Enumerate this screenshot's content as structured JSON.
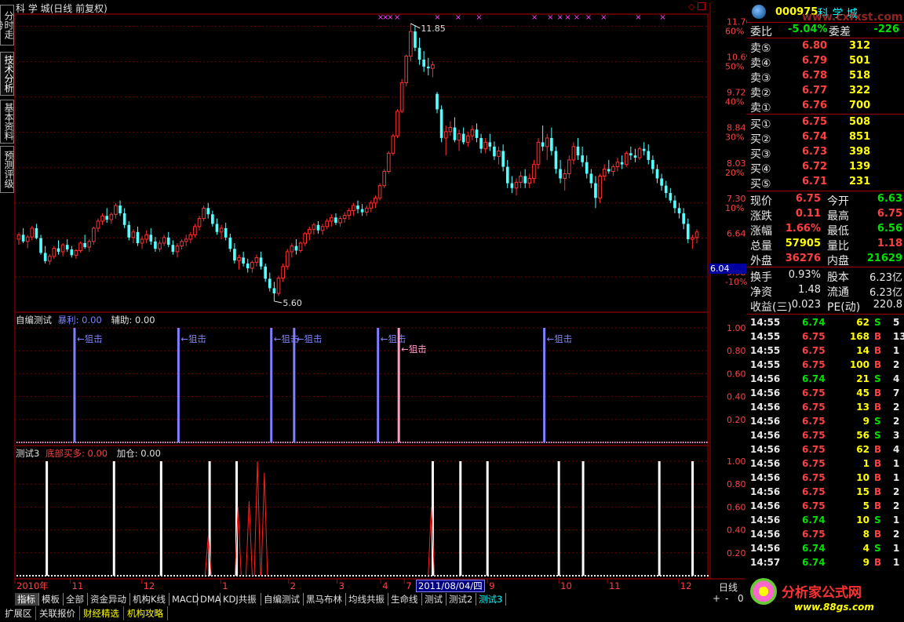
{
  "window": {
    "title": "科 学 城(日线 前复权)"
  },
  "left_tabs": [
    {
      "label": "分时走势",
      "active": false
    },
    {
      "label": "技术分析",
      "active": true
    },
    {
      "label": "基本资料",
      "active": false
    },
    {
      "label": "预测评级",
      "active": false
    }
  ],
  "price_axis": {
    "levels": [
      {
        "price": "11.76",
        "pct": "60%"
      },
      {
        "price": "10.69",
        "pct": "50%"
      },
      {
        "price": "9.72",
        "pct": "40%"
      },
      {
        "price": "8.84",
        "pct": "30%"
      },
      {
        "price": "8.03",
        "pct": "20%"
      },
      {
        "price": "7.30",
        "pct": "10%"
      },
      {
        "price": "6.64",
        "pct": ""
      },
      {
        "price": "5.98",
        "pct": "-10%"
      }
    ],
    "current_price_box": "6.04"
  },
  "annotations": {
    "high_label": "11.85",
    "low_label": "5.60"
  },
  "panel1": {
    "title": "自编测试",
    "l1": "暴利: 0.00",
    "l2": "辅助: 0.00",
    "axis": [
      "1.00",
      "0.80",
      "0.60",
      "0.40",
      "0.20"
    ],
    "signal_text": "←狙击"
  },
  "panel2": {
    "title": "测试3",
    "l1": "底部买多: 0.00",
    "l2": "加仓: 0.00",
    "axis": [
      "1.00",
      "0.80",
      "0.60",
      "0.40",
      "0.20"
    ]
  },
  "time_axis": {
    "labels": [
      "2010年",
      "11",
      "12",
      "1",
      "2",
      "3",
      "4",
      "7",
      "8",
      "9",
      "10",
      "11",
      "12"
    ],
    "cursor_date": "2011/08/04/四",
    "period": "日线"
  },
  "bottom_tabs": [
    "指标",
    "模板",
    "全部",
    "资金异动",
    "机构K线",
    "MACD",
    "DMA",
    "KDJ共振",
    "自编测试",
    "黑马布林",
    "均线共振",
    "生命线",
    "测试",
    "测试2",
    "测试3"
  ],
  "bottom_tab_active": "指标",
  "bottom_tab_highlight": "测试3",
  "scroll_controls": [
    "+",
    "-",
    "0"
  ],
  "ext_tabs": [
    "扩展区",
    "关联报价",
    "财经精选",
    "机构攻略"
  ],
  "quote": {
    "code": "000975",
    "name": "科 学 城",
    "watermark": "www.cxfxst.com",
    "webi": {
      "label": "委比",
      "value": "-5.04%",
      "label2": "委差",
      "value2": "-226"
    },
    "sell": [
      {
        "label": "卖⑤",
        "price": "6.80",
        "vol": "312"
      },
      {
        "label": "卖④",
        "price": "6.79",
        "vol": "501"
      },
      {
        "label": "卖③",
        "price": "6.78",
        "vol": "518"
      },
      {
        "label": "卖②",
        "price": "6.77",
        "vol": "322"
      },
      {
        "label": "卖①",
        "price": "6.76",
        "vol": "700"
      }
    ],
    "buy": [
      {
        "label": "买①",
        "price": "6.75",
        "vol": "508"
      },
      {
        "label": "买②",
        "price": "6.74",
        "vol": "851"
      },
      {
        "label": "买③",
        "price": "6.73",
        "vol": "398"
      },
      {
        "label": "买④",
        "price": "6.72",
        "vol": "139"
      },
      {
        "label": "买⑤",
        "price": "6.71",
        "vol": "231"
      }
    ],
    "stats": [
      {
        "l": "现价",
        "v": "6.75",
        "c": "red",
        "l2": "今开",
        "v2": "6.63",
        "c2": "green"
      },
      {
        "l": "涨跌",
        "v": "0.11",
        "c": "red",
        "l2": "最高",
        "v2": "6.75",
        "c2": "red"
      },
      {
        "l": "涨幅",
        "v": "1.66%",
        "c": "red",
        "l2": "最低",
        "v2": "6.56",
        "c2": "green"
      },
      {
        "l": "总量",
        "v": "57905",
        "c": "yellow",
        "l2": "量比",
        "v2": "1.18",
        "c2": "red"
      },
      {
        "l": "外盘",
        "v": "36276",
        "c": "red",
        "l2": "内盘",
        "v2": "21629",
        "c2": "green"
      }
    ],
    "stats2": [
      {
        "l": "换手",
        "v": "0.93%",
        "l2": "股本",
        "v2": "6.23亿"
      },
      {
        "l": "净资",
        "v": "1.48",
        "l2": "流通",
        "v2": "6.23亿"
      },
      {
        "l": "收益(三)",
        "v": "0.023",
        "l2": "PE(动)",
        "v2": "220.8"
      }
    ],
    "ticks": [
      {
        "t": "14:55",
        "p": "6.74",
        "v": "62",
        "s": "S",
        "n": "5"
      },
      {
        "t": "14:55",
        "p": "6.75",
        "v": "168",
        "s": "B",
        "n": "13"
      },
      {
        "t": "14:55",
        "p": "6.75",
        "v": "14",
        "s": "B",
        "n": "1"
      },
      {
        "t": "14:55",
        "p": "6.75",
        "v": "100",
        "s": "B",
        "n": "2"
      },
      {
        "t": "14:56",
        "p": "6.74",
        "v": "21",
        "s": "S",
        "n": "4"
      },
      {
        "t": "14:56",
        "p": "6.75",
        "v": "45",
        "s": "B",
        "n": "7"
      },
      {
        "t": "14:56",
        "p": "6.75",
        "v": "13",
        "s": "B",
        "n": "2"
      },
      {
        "t": "14:56",
        "p": "6.75",
        "v": "9",
        "s": "S",
        "n": "2"
      },
      {
        "t": "14:56",
        "p": "6.75",
        "v": "56",
        "s": "S",
        "n": "3"
      },
      {
        "t": "14:56",
        "p": "6.75",
        "v": "62",
        "s": "B",
        "n": "4"
      },
      {
        "t": "14:56",
        "p": "6.75",
        "v": "1",
        "s": "B",
        "n": "1"
      },
      {
        "t": "14:56",
        "p": "6.75",
        "v": "10",
        "s": "B",
        "n": "1"
      },
      {
        "t": "14:56",
        "p": "6.75",
        "v": "15",
        "s": "B",
        "n": "2"
      },
      {
        "t": "14:56",
        "p": "6.75",
        "v": "5",
        "s": "B",
        "n": "2"
      },
      {
        "t": "14:56",
        "p": "6.74",
        "v": "10",
        "s": "S",
        "n": "1"
      },
      {
        "t": "14:56",
        "p": "6.75",
        "v": "8",
        "s": "B",
        "n": "2"
      },
      {
        "t": "14:56",
        "p": "6.74",
        "v": "4",
        "s": "S",
        "n": "1"
      },
      {
        "t": "14:57",
        "p": "6.74",
        "v": "9",
        "s": "B",
        "n": "1"
      }
    ],
    "logo_text": "分析家公式网",
    "logo_url_text": "www.88gs.com"
  },
  "colors": {
    "up": "#ff3030",
    "down": "#54ffff",
    "grid": "#700000",
    "axis": "#b00000",
    "signal_blue": "#7f7fff",
    "signal_pink": "#ff99cc",
    "white_bar": "#ffffff"
  },
  "chart_data": {
    "type": "candlestick",
    "title": "科 学 城(日线 前复权)",
    "ylim": [
      5.6,
      11.85
    ],
    "ohlc": [
      [
        6.62,
        6.74,
        6.52,
        6.7
      ],
      [
        6.7,
        6.82,
        6.55,
        6.58
      ],
      [
        6.58,
        6.7,
        6.46,
        6.66
      ],
      [
        6.66,
        6.86,
        6.6,
        6.82
      ],
      [
        6.82,
        6.9,
        6.62,
        6.64
      ],
      [
        6.64,
        6.7,
        6.35,
        6.38
      ],
      [
        6.38,
        6.5,
        6.2,
        6.24
      ],
      [
        6.24,
        6.36,
        6.18,
        6.32
      ],
      [
        6.32,
        6.5,
        6.28,
        6.46
      ],
      [
        6.46,
        6.6,
        6.35,
        6.4
      ],
      [
        6.4,
        6.55,
        6.32,
        6.52
      ],
      [
        6.52,
        6.62,
        6.4,
        6.44
      ],
      [
        6.44,
        6.5,
        6.3,
        6.34
      ],
      [
        6.34,
        6.45,
        6.28,
        6.42
      ],
      [
        6.42,
        6.58,
        6.38,
        6.55
      ],
      [
        6.55,
        6.7,
        6.45,
        6.48
      ],
      [
        6.48,
        6.62,
        6.4,
        6.58
      ],
      [
        6.58,
        6.85,
        6.52,
        6.82
      ],
      [
        6.82,
        7.0,
        6.75,
        6.95
      ],
      [
        6.95,
        7.1,
        6.88,
        7.05
      ],
      [
        7.05,
        7.2,
        6.92,
        6.98
      ],
      [
        6.98,
        7.12,
        6.9,
        7.08
      ],
      [
        7.08,
        7.3,
        7.0,
        7.25
      ],
      [
        7.25,
        7.35,
        7.05,
        7.1
      ],
      [
        7.1,
        7.2,
        6.82,
        6.88
      ],
      [
        6.88,
        6.95,
        6.6,
        6.65
      ],
      [
        6.65,
        6.8,
        6.55,
        6.75
      ],
      [
        6.75,
        6.85,
        6.5,
        6.55
      ],
      [
        6.55,
        6.68,
        6.45,
        6.62
      ],
      [
        6.62,
        6.78,
        6.55,
        6.7
      ],
      [
        6.7,
        6.82,
        6.52,
        6.58
      ],
      [
        6.58,
        6.66,
        6.4,
        6.45
      ],
      [
        6.45,
        6.6,
        6.4,
        6.55
      ],
      [
        6.55,
        6.7,
        6.5,
        6.65
      ],
      [
        6.65,
        6.75,
        6.48,
        6.52
      ],
      [
        6.52,
        6.6,
        6.35,
        6.4
      ],
      [
        6.4,
        6.55,
        6.3,
        6.5
      ],
      [
        6.5,
        6.62,
        6.44,
        6.58
      ],
      [
        6.58,
        6.7,
        6.5,
        6.62
      ],
      [
        6.62,
        6.75,
        6.55,
        6.7
      ],
      [
        6.7,
        6.9,
        6.65,
        6.85
      ],
      [
        6.85,
        7.05,
        6.78,
        7.0
      ],
      [
        7.0,
        7.25,
        6.95,
        7.2
      ],
      [
        7.2,
        7.3,
        7.0,
        7.08
      ],
      [
        7.08,
        7.15,
        6.85,
        6.9
      ],
      [
        6.9,
        7.0,
        6.7,
        6.75
      ],
      [
        6.75,
        6.88,
        6.62,
        6.82
      ],
      [
        6.82,
        6.92,
        6.6,
        6.65
      ],
      [
        6.65,
        6.72,
        6.4,
        6.45
      ],
      [
        6.45,
        6.55,
        6.2,
        6.25
      ],
      [
        6.25,
        6.35,
        6.1,
        6.3
      ],
      [
        6.3,
        6.4,
        6.15,
        6.2
      ],
      [
        6.2,
        6.28,
        6.05,
        6.12
      ],
      [
        6.12,
        6.25,
        6.05,
        6.22
      ],
      [
        6.22,
        6.35,
        6.15,
        6.3
      ],
      [
        6.3,
        6.4,
        6.1,
        6.15
      ],
      [
        6.15,
        6.2,
        5.9,
        5.95
      ],
      [
        5.95,
        6.05,
        5.75,
        5.8
      ],
      [
        5.8,
        5.9,
        5.6,
        5.72
      ],
      [
        5.72,
        6.0,
        5.68,
        5.96
      ],
      [
        5.96,
        6.2,
        5.9,
        6.15
      ],
      [
        6.15,
        6.45,
        6.1,
        6.4
      ],
      [
        6.4,
        6.55,
        6.3,
        6.5
      ],
      [
        6.5,
        6.62,
        6.35,
        6.42
      ],
      [
        6.42,
        6.58,
        6.38,
        6.55
      ],
      [
        6.55,
        6.75,
        6.5,
        6.72
      ],
      [
        6.72,
        6.85,
        6.6,
        6.8
      ],
      [
        6.8,
        6.92,
        6.7,
        6.88
      ],
      [
        6.88,
        6.95,
        6.72,
        6.78
      ],
      [
        6.78,
        6.9,
        6.7,
        6.85
      ],
      [
        6.85,
        7.0,
        6.8,
        6.95
      ],
      [
        6.95,
        7.08,
        6.85,
        7.02
      ],
      [
        7.02,
        7.1,
        6.88,
        6.92
      ],
      [
        6.92,
        7.05,
        6.85,
        7.0
      ],
      [
        7.0,
        7.12,
        6.92,
        7.06
      ],
      [
        7.06,
        7.2,
        6.98,
        7.15
      ],
      [
        7.15,
        7.3,
        7.05,
        7.25
      ],
      [
        7.25,
        7.35,
        7.1,
        7.18
      ],
      [
        7.18,
        7.28,
        7.05,
        7.12
      ],
      [
        7.12,
        7.25,
        7.05,
        7.2
      ],
      [
        7.2,
        7.35,
        7.12,
        7.3
      ],
      [
        7.3,
        7.45,
        7.2,
        7.4
      ],
      [
        7.4,
        7.7,
        7.35,
        7.65
      ],
      [
        7.65,
        8.0,
        7.6,
        7.95
      ],
      [
        7.95,
        8.4,
        7.9,
        8.35
      ],
      [
        8.35,
        8.8,
        8.3,
        8.75
      ],
      [
        8.75,
        9.4,
        8.7,
        9.35
      ],
      [
        9.35,
        10.2,
        9.3,
        10.1
      ],
      [
        10.1,
        10.9,
        10.0,
        10.85
      ],
      [
        10.85,
        11.85,
        10.7,
        11.6
      ],
      [
        11.6,
        11.8,
        11.0,
        11.1
      ],
      [
        11.1,
        11.4,
        10.6,
        10.75
      ],
      [
        10.75,
        11.0,
        10.4,
        10.55
      ],
      [
        10.55,
        10.8,
        10.3,
        10.5
      ],
      [
        10.5,
        10.7,
        10.25,
        10.6
      ],
      [
        9.8,
        9.85,
        9.3,
        9.4
      ],
      [
        9.4,
        9.5,
        8.6,
        8.7
      ],
      [
        8.7,
        9.0,
        8.3,
        8.85
      ],
      [
        8.85,
        9.1,
        8.75,
        8.95
      ],
      [
        8.95,
        9.2,
        8.6,
        8.65
      ],
      [
        8.65,
        8.9,
        8.4,
        8.8
      ],
      [
        8.8,
        8.95,
        8.55,
        8.6
      ],
      [
        8.6,
        8.85,
        8.5,
        8.75
      ],
      [
        8.75,
        9.0,
        8.65,
        8.9
      ],
      [
        8.9,
        9.05,
        8.6,
        8.7
      ],
      [
        8.7,
        8.8,
        8.35,
        8.45
      ],
      [
        8.45,
        8.7,
        8.35,
        8.6
      ],
      [
        8.6,
        8.8,
        8.4,
        8.5
      ],
      [
        8.5,
        8.62,
        8.2,
        8.28
      ],
      [
        8.28,
        8.5,
        8.1,
        8.4
      ],
      [
        8.4,
        8.55,
        7.95,
        8.05
      ],
      [
        8.05,
        8.2,
        7.6,
        7.7
      ],
      [
        7.7,
        7.85,
        7.5,
        7.6
      ],
      [
        7.6,
        7.8,
        7.45,
        7.72
      ],
      [
        7.72,
        7.95,
        7.6,
        7.85
      ],
      [
        7.85,
        8.0,
        7.6,
        7.7
      ],
      [
        7.7,
        7.9,
        7.6,
        7.8
      ],
      [
        7.8,
        8.2,
        7.7,
        8.1
      ],
      [
        8.1,
        8.7,
        8.0,
        8.6
      ],
      [
        8.6,
        9.0,
        8.4,
        8.5
      ],
      [
        8.5,
        8.8,
        8.2,
        8.7
      ],
      [
        8.7,
        8.95,
        8.3,
        8.4
      ],
      [
        8.4,
        8.5,
        7.9,
        8.0
      ],
      [
        8.0,
        8.2,
        7.7,
        7.8
      ],
      [
        7.8,
        8.0,
        7.55,
        7.9
      ],
      [
        7.9,
        8.3,
        7.8,
        8.2
      ],
      [
        8.2,
        8.6,
        8.1,
        8.5
      ],
      [
        8.5,
        8.7,
        8.2,
        8.3
      ],
      [
        8.3,
        8.5,
        8.05,
        8.15
      ],
      [
        8.15,
        8.3,
        7.8,
        7.9
      ],
      [
        7.9,
        8.0,
        7.6,
        7.7
      ],
      [
        7.7,
        7.85,
        7.2,
        7.4
      ],
      [
        7.4,
        7.9,
        7.3,
        7.85
      ],
      [
        7.85,
        8.1,
        7.75,
        8.0
      ],
      [
        8.0,
        8.2,
        7.9,
        7.95
      ],
      [
        7.95,
        8.1,
        7.85,
        8.05
      ],
      [
        8.05,
        8.25,
        7.95,
        8.15
      ],
      [
        8.15,
        8.3,
        8.0,
        8.1
      ],
      [
        8.1,
        8.4,
        8.05,
        8.35
      ],
      [
        8.35,
        8.5,
        8.2,
        8.3
      ],
      [
        8.3,
        8.45,
        8.15,
        8.25
      ],
      [
        8.25,
        8.5,
        8.2,
        8.45
      ],
      [
        8.45,
        8.6,
        8.3,
        8.4
      ],
      [
        8.4,
        8.55,
        8.1,
        8.2
      ],
      [
        8.2,
        8.3,
        7.9,
        8.0
      ],
      [
        8.0,
        8.1,
        7.7,
        7.8
      ],
      [
        7.8,
        7.9,
        7.55,
        7.65
      ],
      [
        7.65,
        7.75,
        7.4,
        7.5
      ],
      [
        7.5,
        7.6,
        7.3,
        7.35
      ],
      [
        7.35,
        7.45,
        7.1,
        7.2
      ],
      [
        7.2,
        7.3,
        7.0,
        7.1
      ],
      [
        7.1,
        7.2,
        6.8,
        6.9
      ],
      [
        6.9,
        7.0,
        6.55,
        6.62
      ],
      [
        6.62,
        6.7,
        6.45,
        6.65
      ],
      [
        6.65,
        6.8,
        6.55,
        6.75
      ]
    ],
    "panel1_signals": [
      {
        "x": 0.086,
        "color": "signal_blue",
        "label": true
      },
      {
        "x": 0.236,
        "color": "signal_blue",
        "label": true
      },
      {
        "x": 0.37,
        "color": "signal_blue",
        "label": true
      },
      {
        "x": 0.403,
        "color": "signal_blue",
        "label": true
      },
      {
        "x": 0.524,
        "color": "signal_blue",
        "label": true
      },
      {
        "x": 0.554,
        "color": "signal_pink",
        "label": true
      },
      {
        "x": 0.764,
        "color": "signal_blue",
        "label": true
      }
    ],
    "panel2_bars": [
      0.046,
      0.143,
      0.211,
      0.281,
      0.32,
      0.603,
      0.643,
      0.682,
      0.785,
      0.82,
      0.93,
      0.978
    ],
    "panel2_spikes": [
      {
        "x": 0.279,
        "h": 0.35
      },
      {
        "x": 0.322,
        "h": 0.6
      },
      {
        "x": 0.338,
        "h": 0.65
      },
      {
        "x": 0.35,
        "h": 1.0
      },
      {
        "x": 0.36,
        "h": 0.9
      },
      {
        "x": 0.601,
        "h": 0.6
      }
    ],
    "top_markers": [
      0.523,
      0.53,
      0.537,
      0.547,
      0.605,
      0.635,
      0.665,
      0.745,
      0.768,
      0.782,
      0.793,
      0.806,
      0.823,
      0.845,
      0.895,
      0.93
    ]
  }
}
